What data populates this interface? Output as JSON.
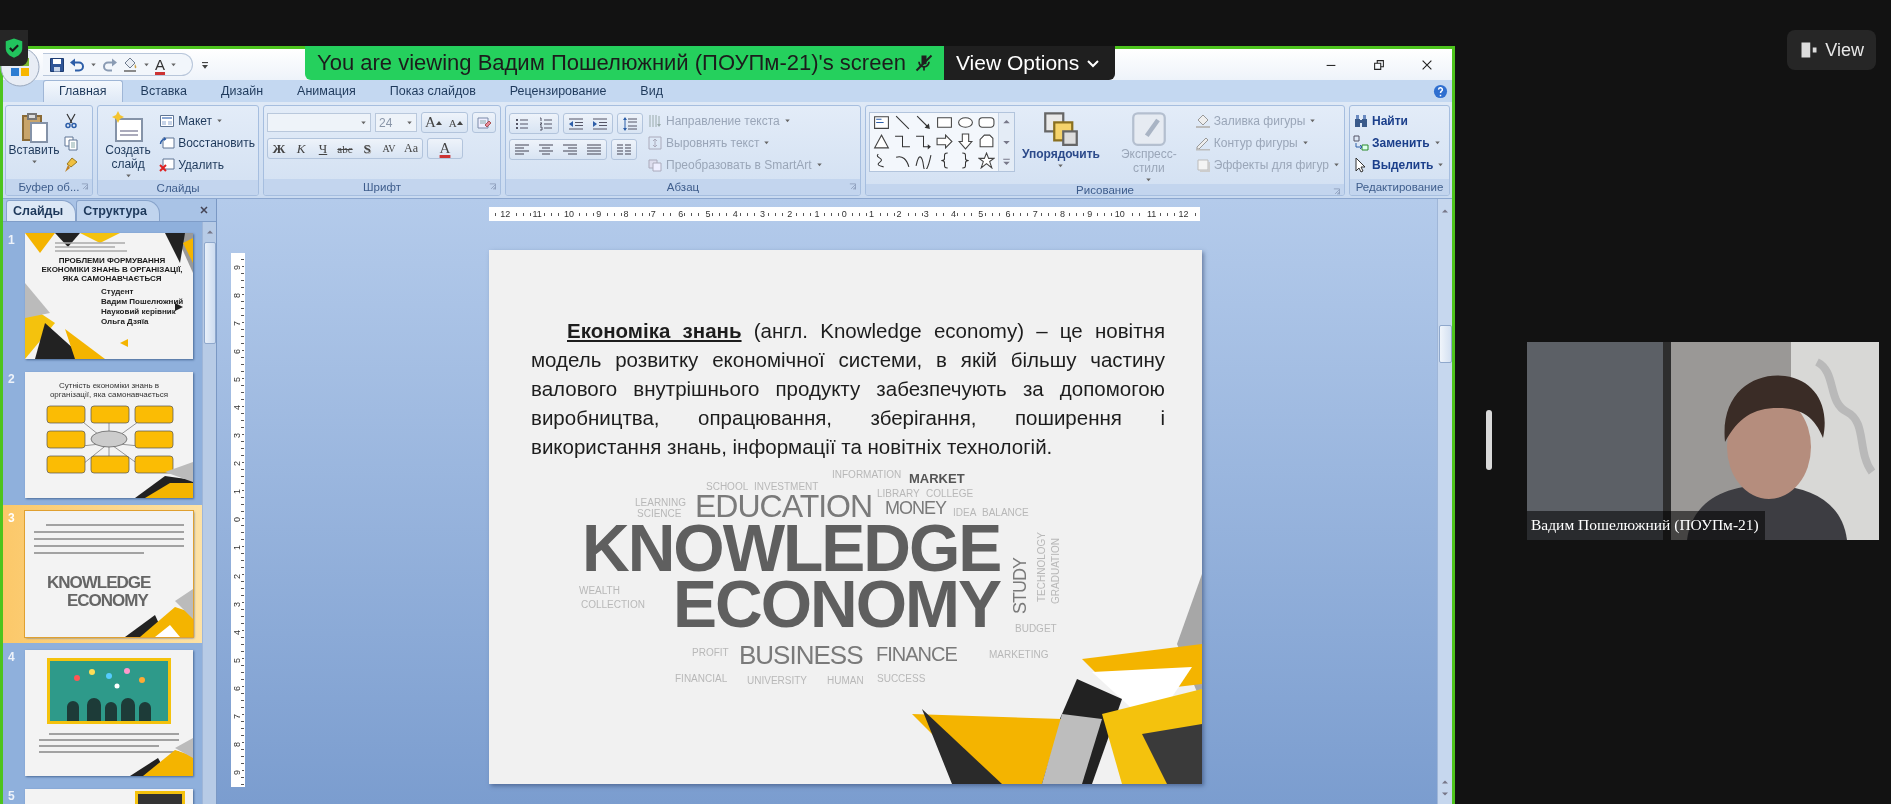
{
  "share_banner": {
    "text": "You are viewing Вадим Пошелюжний (ПОУПм-21)'s screen",
    "view_options": "View Options"
  },
  "view_button": {
    "label": "View"
  },
  "powerpoint": {
    "quick_access": {
      "font_color": "A"
    },
    "tabs": [
      {
        "label": "Главная",
        "selected": true
      },
      {
        "label": "Вставка",
        "selected": false
      },
      {
        "label": "Дизайн",
        "selected": false
      },
      {
        "label": "Анимация",
        "selected": false
      },
      {
        "label": "Показ слайдов",
        "selected": false
      },
      {
        "label": "Рецензирование",
        "selected": false
      },
      {
        "label": "Вид",
        "selected": false
      }
    ],
    "ribbon": {
      "clipboard": {
        "label": "Буфер об...",
        "paste": "Вставить"
      },
      "slides": {
        "label": "Слайды",
        "new_slide": "Создать слайд",
        "items": [
          {
            "label": "Макет",
            "disabled": false
          },
          {
            "label": "Восстановить",
            "disabled": false
          },
          {
            "label": "Удалить",
            "disabled": false
          }
        ]
      },
      "font": {
        "label": "Шрифт",
        "font_size": "24",
        "grow": "A",
        "shrink": "A",
        "format_buttons": [
          "Ж",
          "К",
          "Ч",
          "abc",
          "S",
          "AV",
          "Aa"
        ],
        "font_color": "A"
      },
      "paragraph": {
        "label": "Абзац",
        "items": [
          {
            "label": "Направление текста",
            "disabled": true
          },
          {
            "label": "Выровнять текст",
            "disabled": true
          },
          {
            "label": "Преобразовать в SmartArt",
            "disabled": true
          }
        ]
      },
      "drawing": {
        "label": "Рисование",
        "big": [
          {
            "label": "Упорядочить",
            "disabled": false
          },
          {
            "label": "Экспресс-стили",
            "disabled": true
          }
        ],
        "items": [
          {
            "label": "Заливка фигуры",
            "disabled": true
          },
          {
            "label": "Контур фигуры",
            "disabled": true
          },
          {
            "label": "Эффекты для фигур",
            "disabled": true
          }
        ]
      },
      "editing": {
        "label": "Редактирование",
        "items": [
          {
            "label": "Найти",
            "disabled": false
          },
          {
            "label": "Заменить",
            "disabled": false
          },
          {
            "label": "Выделить",
            "disabled": false
          }
        ]
      }
    },
    "pane": {
      "tabs": [
        {
          "label": "Слайды",
          "selected": true
        },
        {
          "label": "Структура",
          "selected": false
        }
      ],
      "thumbnails": [
        {
          "number": "1",
          "kind": "title",
          "selected": false,
          "title": "ПРОБЛЕМИ ФОРМУВАННЯ ЕКОНОМІКИ ЗНАНЬ В ОРГАНІЗАЦІЇ, ЯКА САМОНАВЧАЄТЬСЯ",
          "lines": [
            "Студент",
            "Вадим Пошелюжний",
            "Науковий керівник",
            "Ольга Дзяїа"
          ]
        },
        {
          "number": "2",
          "kind": "diagram",
          "selected": false,
          "title": "Сутність економіки знань в організації, яка самонавчається"
        },
        {
          "number": "3",
          "kind": "text",
          "selected": true,
          "words": [
            "KNOWLEDGE",
            "ECONOMY"
          ]
        },
        {
          "number": "4",
          "kind": "picture",
          "selected": false
        },
        {
          "number": "5",
          "kind": "partial",
          "selected": false
        }
      ]
    },
    "h_ruler": [
      "12",
      "11",
      "10",
      "9",
      "8",
      "7",
      "6",
      "5",
      "4",
      "3",
      "2",
      "1",
      "0",
      "1",
      "2",
      "3",
      "4",
      "5",
      "6",
      "7",
      "8",
      "9",
      "10",
      "11",
      "12"
    ],
    "v_ruler": [
      "9",
      "8",
      "7",
      "6",
      "5",
      "4",
      "3",
      "2",
      "1",
      "0",
      "1",
      "2",
      "3",
      "4",
      "5",
      "6",
      "7",
      "8",
      "9"
    ],
    "slide": {
      "paragraph": "**Економіка знань** (англ. Knowledge economy) – це новітня модель розвитку економічної системи, в якій більшу частину валового внутрішнього продукту забезпечують за допомогою виробництва, опрацювання, зберігання, поширення і використання знань, інформації та новітніх технологій.",
      "word_cloud": [
        {
          "text": "INFORMATION",
          "kind": "minor"
        },
        {
          "text": "MARKET",
          "kind": "label"
        },
        {
          "text": "SCHOOL",
          "kind": "minor"
        },
        {
          "text": "INVESTMENT",
          "kind": "minor"
        },
        {
          "text": "LIBRARY",
          "kind": "minor"
        },
        {
          "text": "COLLEGE",
          "kind": "minor"
        },
        {
          "text": "LEARNING",
          "kind": "minor"
        },
        {
          "text": "SCIENCE",
          "kind": "minor"
        },
        {
          "text": "EDUCATION",
          "kind": "major"
        },
        {
          "text": "MONEY",
          "kind": "major"
        },
        {
          "text": "IDEA",
          "kind": "minor"
        },
        {
          "text": "BALANCE",
          "kind": "minor"
        },
        {
          "text": "KNOWLEDGE",
          "kind": "main"
        },
        {
          "text": "WEALTH",
          "kind": "minor"
        },
        {
          "text": "COLLECTION",
          "kind": "minor"
        },
        {
          "text": "ECONOMY",
          "kind": "main"
        },
        {
          "text": "STUDY",
          "kind": "major"
        },
        {
          "text": "TECHNOLOGY",
          "kind": "minor"
        },
        {
          "text": "GRADUATION",
          "kind": "minor"
        },
        {
          "text": "BUDGET",
          "kind": "minor"
        },
        {
          "text": "PROFIT",
          "kind": "minor"
        },
        {
          "text": "BUSINESS",
          "kind": "major"
        },
        {
          "text": "FINANCE",
          "kind": "major"
        },
        {
          "text": "MARKETING",
          "kind": "minor"
        },
        {
          "text": "FINANCIAL",
          "kind": "minor"
        },
        {
          "text": "UNIVERSITY",
          "kind": "minor"
        },
        {
          "text": "HUMAN",
          "kind": "minor"
        },
        {
          "text": "SUCCESS",
          "kind": "minor"
        }
      ]
    }
  },
  "video": {
    "name": "Вадим Пошелюжний (ПОУПм-21)"
  }
}
